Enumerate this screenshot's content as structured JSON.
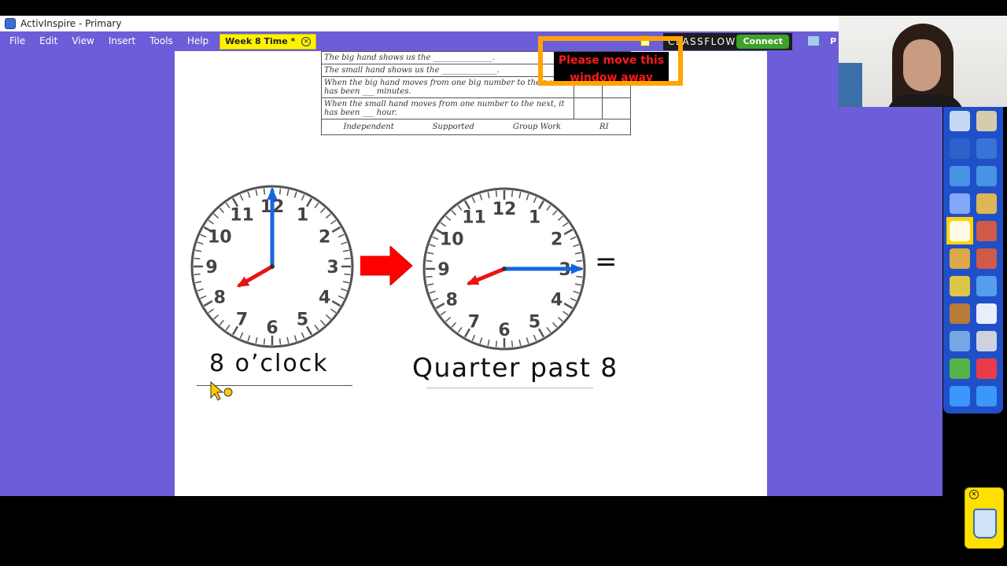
{
  "window": {
    "title": "ActivInspire - Primary"
  },
  "menu": {
    "items": [
      "File",
      "Edit",
      "View",
      "Insert",
      "Tools",
      "Help"
    ],
    "active_tab": "Week 8 Time *",
    "tab_close_icon": "close-circle-icon"
  },
  "classflow": {
    "label": "CLASSFLOW",
    "connect_label": "Connect",
    "clipped_label": "P"
  },
  "popup": {
    "text": "Please move this window away from"
  },
  "worksheet": {
    "rows": [
      "The big hand shows us the _______________.",
      "The small hand shows us the ______________.",
      "When the big hand moves from one big number to the next, it has been ___ minutes.",
      "When the small hand moves from one number to the next, it has been ___ hour."
    ],
    "footer": [
      "Independent",
      "Supported",
      "Group Work",
      "RI"
    ]
  },
  "clocks": [
    {
      "numbers": [
        "12",
        "1",
        "2",
        "3",
        "4",
        "5",
        "6",
        "7",
        "8",
        "9",
        "10",
        "11"
      ],
      "hour": 8,
      "minute": 0,
      "caption": "8 o’clock"
    },
    {
      "numbers": [
        "12",
        "1",
        "2",
        "3",
        "4",
        "5",
        "6",
        "7",
        "8",
        "9",
        "10",
        "11"
      ],
      "hour": 8,
      "minute": 15,
      "caption": "Quarter past 8"
    }
  ],
  "equals_sign": "=",
  "colors": {
    "menu_bg": "#6c5ed8",
    "tab_bg": "#fff200",
    "popup_border": "#ffa400",
    "popup_text": "#ff1a1a",
    "minute_hand": "#1565e0",
    "hour_hand": "#e81313",
    "arrow": "#ff0000",
    "toolbox_bg": "#2050c8"
  },
  "toolbox": {
    "tools": [
      "flipchart-browser-icon",
      "user-icon",
      "pen-tray-icon",
      "tools-icon",
      "previous-page-icon",
      "next-page-icon",
      "play-icon",
      "globe-icon",
      "select-icon",
      "settings-icon",
      "pen-icon",
      "fill-icon",
      "shape-icon",
      "connector-icon",
      "toolbox-icon",
      "text-icon",
      "resource-library-icon",
      "duplicate-icon",
      "reset-page-icon",
      "refresh-icon",
      "undo-icon",
      "redo-icon"
    ]
  },
  "trash": {
    "icon": "trash-icon"
  }
}
